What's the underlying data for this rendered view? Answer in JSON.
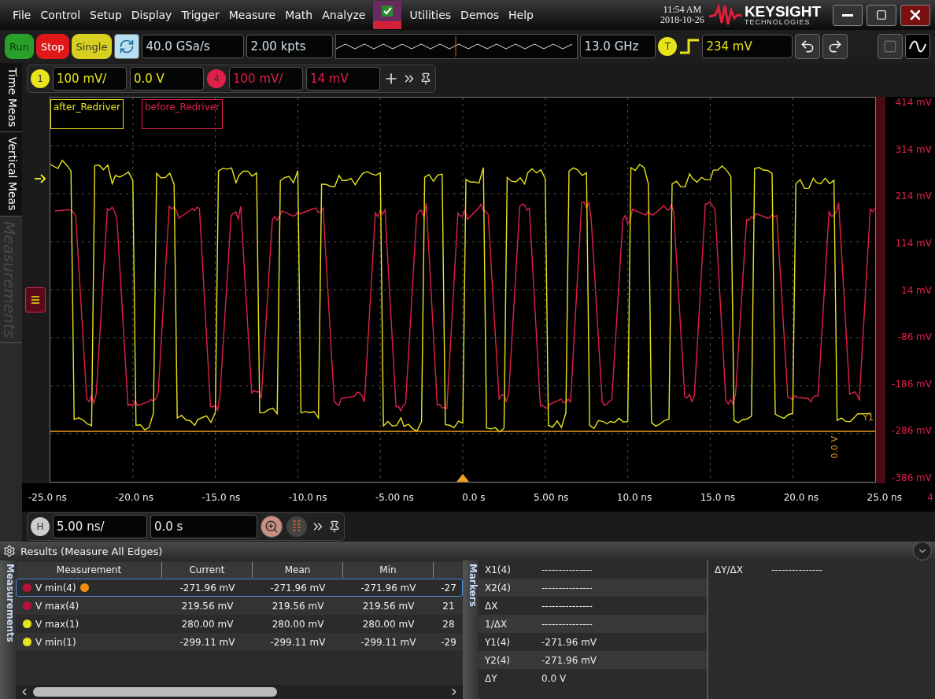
{
  "menu": {
    "items": [
      "File",
      "Control",
      "Setup",
      "Display",
      "Trigger",
      "Measure",
      "Math",
      "Analyze",
      "Utilities",
      "Demos",
      "Help"
    ]
  },
  "clock": {
    "time": "11:54 AM",
    "date": "2018-10-26"
  },
  "logo": {
    "name": "KEYSIGHT",
    "tagline": "TECHNOLOGIES"
  },
  "toolbar": {
    "buttons": [
      {
        "label": "Run",
        "kind": "run"
      },
      {
        "label": "Stop",
        "kind": "stop"
      },
      {
        "label": "Single",
        "kind": "single"
      }
    ],
    "sample_rate": "40.0 GSa/s",
    "memory_depth": "2.00 kpts",
    "bandwidth": "13.0 GHz",
    "trigger_badge": "T",
    "trigger_level": "234 mV"
  },
  "channels": [
    {
      "number": "1",
      "scale": "100 mV/",
      "offset": "0.0 V",
      "color": "#e8e41c"
    },
    {
      "number": "4",
      "scale": "100 mV/",
      "offset": "14 mV",
      "color": "#e0204a"
    }
  ],
  "side_tabs": [
    {
      "label": "Time Meas",
      "disabled": false
    },
    {
      "label": "Vertical Meas",
      "disabled": false
    },
    {
      "label": "Measurements",
      "disabled": true
    }
  ],
  "plot": {
    "legends": [
      {
        "label": "after_Redriver",
        "color": "#e8e41c"
      },
      {
        "label": "before_Redriver",
        "color": "#e0204a"
      }
    ],
    "y_labels": [
      "414 mV",
      "314 mV",
      "214 mV",
      "114 mV",
      "14 mV",
      "-86 mV",
      "-186 mV",
      "-286 mV",
      "-386 mV"
    ],
    "x_labels": [
      "-25.0 ns",
      "-20.0 ns",
      "-15.0 ns",
      "-10.0 ns",
      "-5.00 ns",
      "0.0 s",
      "5.00 ns",
      "10.0 ns",
      "15.0 ns",
      "20.0 ns",
      "25.0 ns"
    ],
    "channel_tag": "4",
    "cursor_label": "Y1",
    "cursor_value": "0.0 V"
  },
  "horizontal": {
    "badge": "H",
    "scale": "5.00 ns/",
    "position": "0.0 s"
  },
  "results": {
    "title": "Results (Measure All Edges)",
    "tab": "Measurements",
    "columns": [
      "Measurement",
      "Current",
      "Mean",
      "Min"
    ],
    "rows": [
      {
        "name": "V min(4)",
        "color": "#b8123a",
        "selected": true,
        "marked": true,
        "values": [
          "-271.96 mV",
          "-271.96 mV",
          "-271.96 mV",
          "-27"
        ]
      },
      {
        "name": "V max(4)",
        "color": "#b8123a",
        "selected": false,
        "marked": false,
        "values": [
          "219.56 mV",
          "219.56 mV",
          "219.56 mV",
          "21"
        ]
      },
      {
        "name": "V max(1)",
        "color": "#e8e41c",
        "selected": false,
        "marked": false,
        "values": [
          "280.00 mV",
          "280.00 mV",
          "280.00 mV",
          "28"
        ]
      },
      {
        "name": "V min(1)",
        "color": "#e8e41c",
        "selected": false,
        "marked": false,
        "values": [
          "-299.11 mV",
          "-299.11 mV",
          "-299.11 mV",
          "-29"
        ]
      }
    ]
  },
  "markers": {
    "tab": "Markers",
    "rows": [
      {
        "label": "X1(4)",
        "value": "---------------"
      },
      {
        "label": "X2(4)",
        "value": "---------------"
      },
      {
        "label": "ΔX",
        "value": "---------------"
      },
      {
        "label": "1/ΔX",
        "value": "---------------"
      },
      {
        "label": "Y1(4)",
        "value": "-271.96 mV"
      },
      {
        "label": "Y2(4)",
        "value": "-271.96 mV"
      },
      {
        "label": "ΔY",
        "value": "0.0 V"
      }
    ],
    "ratio": {
      "label": "ΔY/ΔX",
      "value": "---------------"
    }
  }
}
